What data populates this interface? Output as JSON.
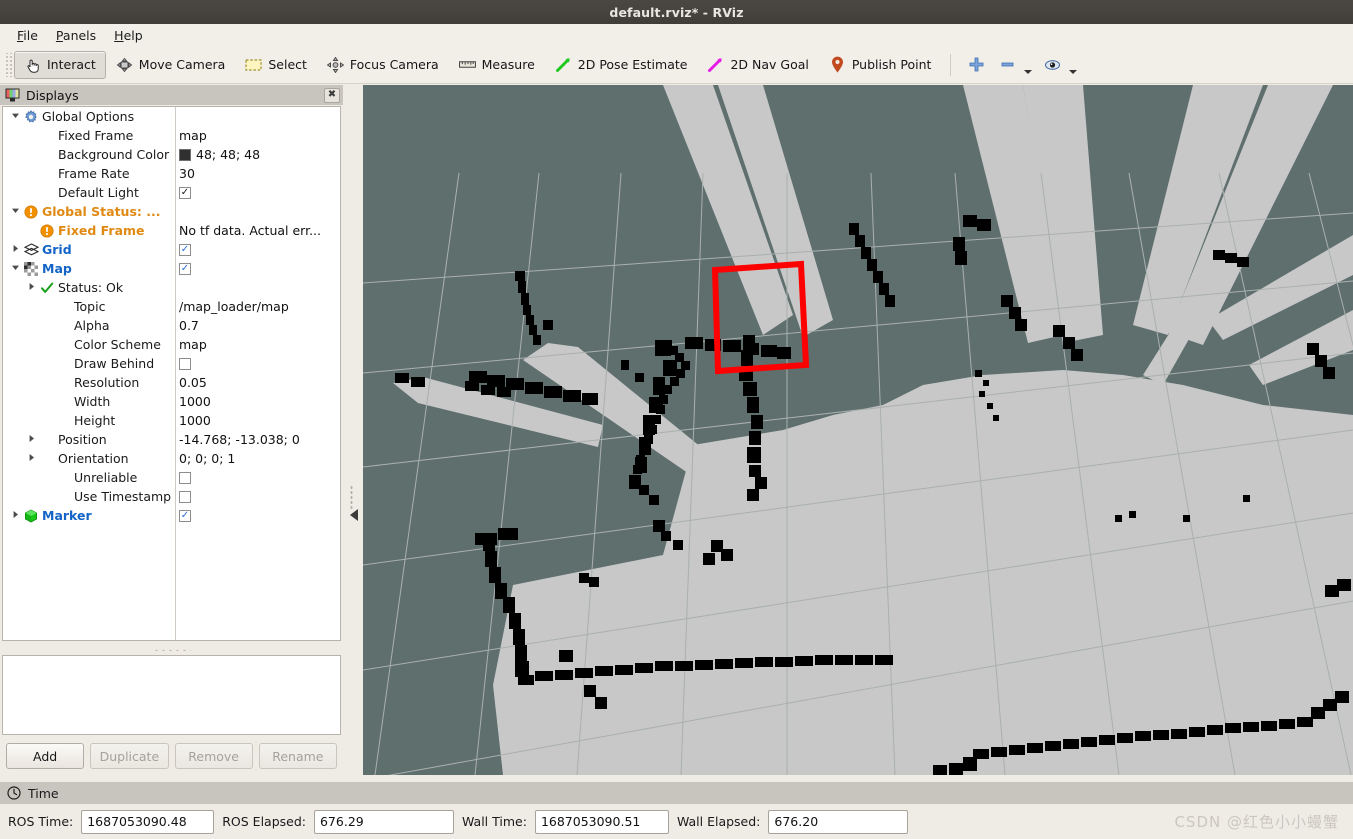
{
  "window": {
    "title": "default.rviz* - RViz"
  },
  "menu": {
    "items": [
      {
        "label": "File",
        "mnemonic": "F"
      },
      {
        "label": "Panels",
        "mnemonic": "P"
      },
      {
        "label": "Help",
        "mnemonic": "H"
      }
    ]
  },
  "toolbar": {
    "tools": [
      {
        "label": "Interact",
        "icon": "hand-cursor-icon",
        "active": true
      },
      {
        "label": "Move Camera",
        "icon": "move-camera-icon",
        "active": false
      },
      {
        "label": "Select",
        "icon": "select-rect-icon",
        "active": false
      },
      {
        "label": "Focus Camera",
        "icon": "focus-camera-icon",
        "active": false
      },
      {
        "label": "Measure",
        "icon": "ruler-icon",
        "active": false
      },
      {
        "label": "2D Pose Estimate",
        "icon": "green-arrow-icon",
        "active": false
      },
      {
        "label": "2D Nav Goal",
        "icon": "magenta-arrow-icon",
        "active": false
      },
      {
        "label": "Publish Point",
        "icon": "map-pin-icon",
        "active": false
      }
    ],
    "extra": [
      {
        "icon": "plus-icon",
        "dropdown": false
      },
      {
        "icon": "minus-icon",
        "dropdown": true
      },
      {
        "icon": "eye-icon",
        "dropdown": true
      }
    ]
  },
  "displays": {
    "panel_title": "Displays",
    "close_label": "✖",
    "rows": [
      {
        "indent": 0,
        "arrow": "down",
        "icon": "gear-icon",
        "label": "Global Options",
        "style": "plain",
        "value": "",
        "value_type": "none"
      },
      {
        "indent": 1,
        "arrow": "none",
        "icon": "none",
        "label": "Fixed Frame",
        "style": "plain",
        "value": "map",
        "value_type": "text"
      },
      {
        "indent": 1,
        "arrow": "none",
        "icon": "none",
        "label": "Background Color",
        "style": "plain",
        "value": "48; 48; 48",
        "value_type": "color",
        "color": "#303030"
      },
      {
        "indent": 1,
        "arrow": "none",
        "icon": "none",
        "label": "Frame Rate",
        "style": "plain",
        "value": "30",
        "value_type": "text"
      },
      {
        "indent": 1,
        "arrow": "none",
        "icon": "none",
        "label": "Default Light",
        "style": "plain",
        "value": "checked-dark",
        "value_type": "checkbox"
      },
      {
        "indent": 0,
        "arrow": "down",
        "icon": "warning-icon",
        "label": "Global Status: ...",
        "style": "orange",
        "value": "",
        "value_type": "none"
      },
      {
        "indent": 1,
        "arrow": "none",
        "icon": "warning-icon",
        "label": "Fixed Frame",
        "style": "orange",
        "value": "No tf data.  Actual err...",
        "value_type": "text"
      },
      {
        "indent": 0,
        "arrow": "right",
        "icon": "grid-icon",
        "label": "Grid",
        "style": "blue",
        "value": "checked-blue",
        "value_type": "checkbox"
      },
      {
        "indent": 0,
        "arrow": "down",
        "icon": "map-icon",
        "label": "Map",
        "style": "blue",
        "value": "checked-blue",
        "value_type": "checkbox"
      },
      {
        "indent": 1,
        "arrow": "right",
        "icon": "ok-icon",
        "label": "Status: Ok",
        "style": "plain",
        "value": "",
        "value_type": "none"
      },
      {
        "indent": 2,
        "arrow": "none",
        "icon": "none",
        "label": "Topic",
        "style": "plain",
        "value": "/map_loader/map",
        "value_type": "text"
      },
      {
        "indent": 2,
        "arrow": "none",
        "icon": "none",
        "label": "Alpha",
        "style": "plain",
        "value": "0.7",
        "value_type": "text"
      },
      {
        "indent": 2,
        "arrow": "none",
        "icon": "none",
        "label": "Color Scheme",
        "style": "plain",
        "value": "map",
        "value_type": "text"
      },
      {
        "indent": 2,
        "arrow": "none",
        "icon": "none",
        "label": "Draw Behind",
        "style": "plain",
        "value": "unchecked",
        "value_type": "checkbox"
      },
      {
        "indent": 2,
        "arrow": "none",
        "icon": "none",
        "label": "Resolution",
        "style": "plain",
        "value": "0.05",
        "value_type": "text"
      },
      {
        "indent": 2,
        "arrow": "none",
        "icon": "none",
        "label": "Width",
        "style": "plain",
        "value": "1000",
        "value_type": "text"
      },
      {
        "indent": 2,
        "arrow": "none",
        "icon": "none",
        "label": "Height",
        "style": "plain",
        "value": "1000",
        "value_type": "text"
      },
      {
        "indent": 1,
        "arrow": "right",
        "icon": "none",
        "label": "Position",
        "style": "plain",
        "value": "-14.768; -13.038; 0",
        "value_type": "text"
      },
      {
        "indent": 1,
        "arrow": "right",
        "icon": "none",
        "label": "Orientation",
        "style": "plain",
        "value": "0; 0; 0; 1",
        "value_type": "text"
      },
      {
        "indent": 2,
        "arrow": "none",
        "icon": "none",
        "label": "Unreliable",
        "style": "plain",
        "value": "unchecked",
        "value_type": "checkbox"
      },
      {
        "indent": 2,
        "arrow": "none",
        "icon": "none",
        "label": "Use Timestamp",
        "style": "plain",
        "value": "unchecked",
        "value_type": "checkbox"
      },
      {
        "indent": 0,
        "arrow": "right",
        "icon": "marker-icon",
        "label": "Marker",
        "style": "blue",
        "value": "checked-blue",
        "value_type": "checkbox"
      }
    ],
    "buttons": [
      {
        "label": "Add",
        "enabled": true
      },
      {
        "label": "Duplicate",
        "enabled": false
      },
      {
        "label": "Remove",
        "enabled": false
      },
      {
        "label": "Rename",
        "enabled": false
      }
    ]
  },
  "viewport": {
    "background_color": "#5f6f6e",
    "free_space_color": "#c8c8c8",
    "occupied_color": "#000000",
    "grid_line_color": "#a9b0ae",
    "marker_color": "#ff0000"
  },
  "time_panel": {
    "title": "Time",
    "fields": [
      {
        "label": "ROS Time:",
        "value": "1687053090.48"
      },
      {
        "label": "ROS Elapsed:",
        "value": "676.29"
      },
      {
        "label": "Wall Time:",
        "value": "1687053090.51"
      },
      {
        "label": "Wall Elapsed:",
        "value": "676.20"
      }
    ]
  },
  "watermark": {
    "text": "CSDN @红色小小蟃蟹"
  }
}
